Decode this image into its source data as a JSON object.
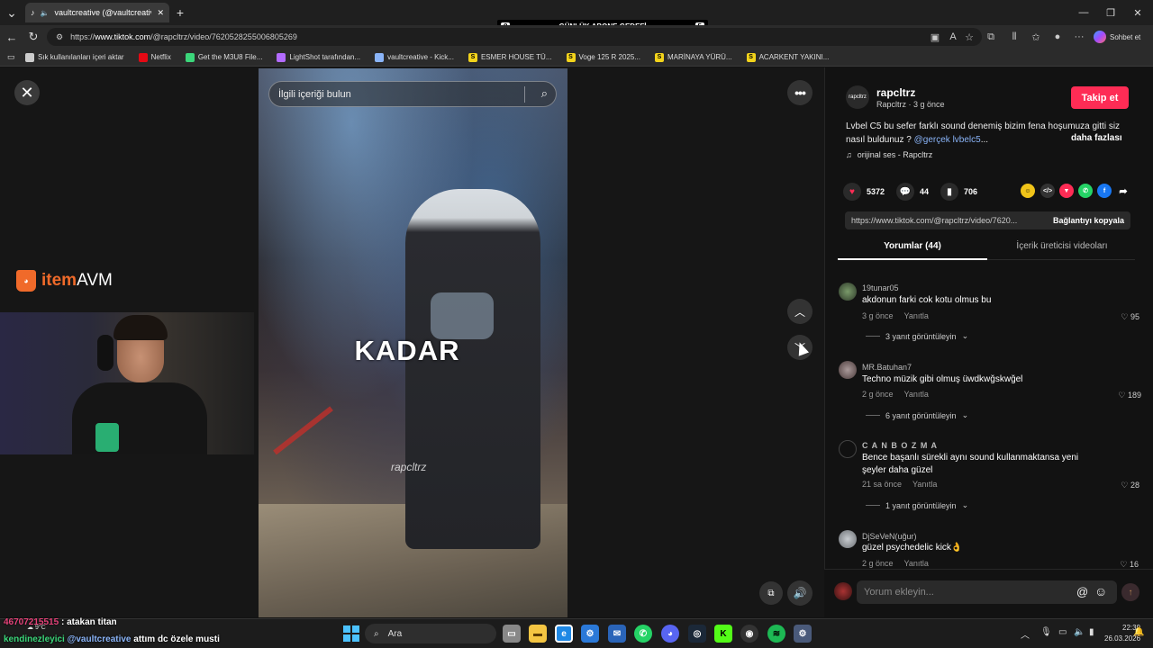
{
  "tab": {
    "title": "vaultcreative (@vaultcreative) ..."
  },
  "goal": {
    "left": "8",
    "title": "GÜNLÜK ABONE GEDEFİ",
    "right": "5"
  },
  "address": {
    "prefix": "https://",
    "host": "www.tiktok.com",
    "path": "/@rapcltrz/video/7620528255006805269"
  },
  "browser": {
    "chat_label": "Sohbet et"
  },
  "bookmarks": [
    {
      "label": "Sık kullanılanları içeri aktar",
      "color": "#cccccc",
      "icon": "import-icon"
    },
    {
      "label": "Netflix",
      "color": "#e50914",
      "icon": "netflix-icon"
    },
    {
      "label": "Get the M3U8 File...",
      "color": "#3bd67a",
      "icon": "globe-icon"
    },
    {
      "label": "LightShot tarafından...",
      "color": "#b36bff",
      "icon": "feather-icon"
    },
    {
      "label": "vaultcreative - Kick...",
      "color": "#8ab4f8",
      "icon": "link-icon"
    },
    {
      "label": "ESMER HOUSE TÜ...",
      "color": "#f2d31b",
      "icon": "s-icon"
    },
    {
      "label": "Voge 125 R 2025...",
      "color": "#f2d31b",
      "icon": "s-icon"
    },
    {
      "label": "MARİNAYA YÜRÜ...",
      "color": "#f2d31b",
      "icon": "s-icon"
    },
    {
      "label": "ACARKENT YAKINI...",
      "color": "#f2d31b",
      "icon": "s-icon"
    }
  ],
  "video": {
    "search_placeholder": "İlgili içeriği bulun",
    "caption": "KADAR",
    "watermark": "rapcltrz"
  },
  "stream": {
    "brand_item": "item",
    "brand_avm": "AVM"
  },
  "post": {
    "username": "rapcltrz",
    "sub": "Rapcltrz · 3 g önce",
    "avatar_text": "rapcltrz",
    "follow_label": "Takip et",
    "description": "Lvbel C5 bu sefer farklı sound denemiş bizim fena hoşumuza gitti siz nasıl buldunuz ? ",
    "mention": "@gerçek lvbelc5",
    "ellipsis": "...",
    "more_label": "daha fazlası",
    "music": "orijinal ses - Rapcltrz",
    "likes": "5372",
    "comments": "44",
    "saves": "706",
    "link": "https://www.tiktok.com/@rapcltrz/video/7620...",
    "copy_label": "Bağlantıyı kopyala"
  },
  "tabs": {
    "comments": "Yorumlar (44)",
    "creator": "İçerik üreticisi videoları"
  },
  "comments": [
    {
      "user": "19tunar05",
      "text": "akdonun farki cok kotu olmus bu",
      "time": "3 g önce",
      "reply": "Yanıtla",
      "likes": "95",
      "replies": "3 yanıt görüntüleyin"
    },
    {
      "user": "MR.Batuhan7",
      "text": "Techno müzik gibi olmuş üwdkwğskwğel",
      "time": "2 g önce",
      "reply": "Yanıtla",
      "likes": "189",
      "replies": "6 yanıt görüntüleyin"
    },
    {
      "user": "C A N B O Z M A",
      "text": "Bence başanlı sürekli aynı sound kullanmaktansa yeni şeyler daha güzel",
      "time": "21 sa önce",
      "reply": "Yanıtla",
      "likes": "28",
      "replies": "1 yanıt görüntüleyin"
    },
    {
      "user": "DjSeVeN(uğur)",
      "text": "güzel psychedelic kick👌",
      "time": "2 g önce",
      "reply": "Yanıtla",
      "likes": "16",
      "replies": ""
    }
  ],
  "comment_input": {
    "placeholder": "Yorum ekleyin..."
  },
  "chat": [
    {
      "user": "46707215515",
      "text": ": atakan titan"
    },
    {
      "user": "kendinezleyici",
      "mention": "@vaultcreative",
      "text": " attım dc özele musti"
    }
  ],
  "taskbar": {
    "weather": "9°C",
    "search_label": "Ara",
    "time": "22:39",
    "date": "26.03.2026"
  }
}
